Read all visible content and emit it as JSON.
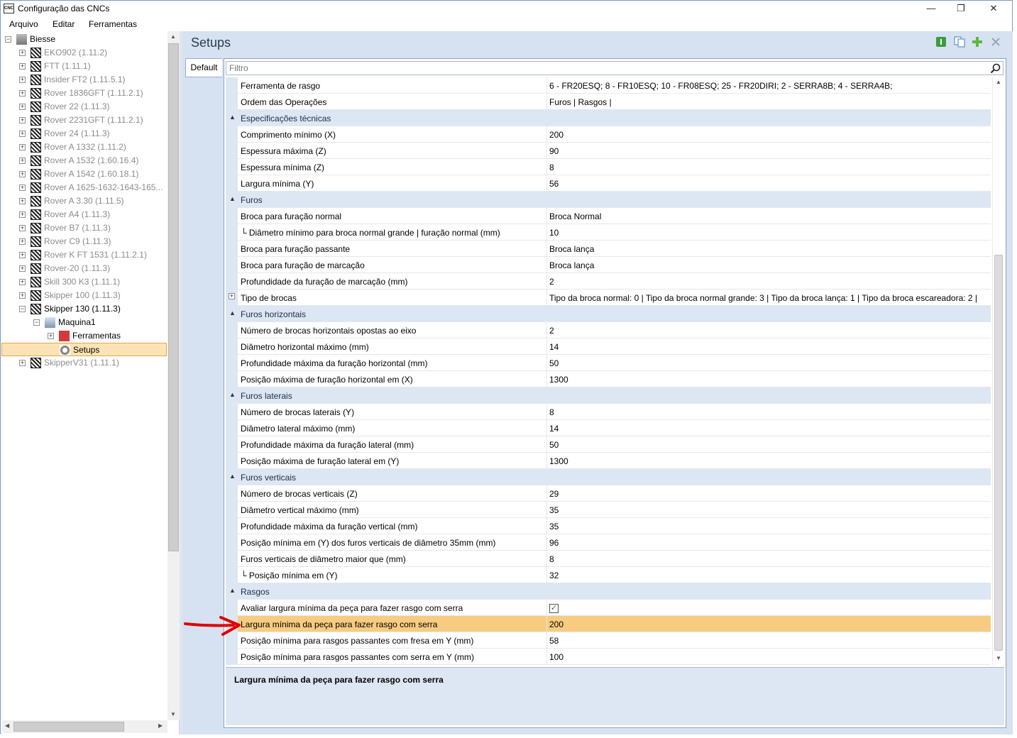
{
  "window": {
    "app_icon_text": "CNC",
    "title": "Configuração das CNCs",
    "controls": [
      "—",
      "❐",
      "✕"
    ]
  },
  "menu": [
    "Arquivo",
    "Editar",
    "Ferramentas"
  ],
  "tree": {
    "root": "Biesse",
    "machines": [
      "EKO902 (1.11.2)",
      "FTT (1.11.1)",
      "Insider FT2 (1.11.5.1)",
      "Rover 1836GFT (1.11.2.1)",
      "Rover 22 (1.11.3)",
      "Rover 2231GFT (1.11.2.1)",
      "Rover 24 (1.11.3)",
      "Rover A 1332 (1.11.2)",
      "Rover A 1532 (1.60.16.4)",
      "Rover A 1542 (1.60.18.1)",
      "Rover A 1625-1632-1643-165...",
      "Rover A 3.30 (1.11.5)",
      "Rover A4 (1.11.3)",
      "Rover B7 (1.11.3)",
      "Rover C9 (1.11.3)",
      "Rover K FT 1531 (1.11.2.1)",
      "Rover-20 (1.11.3)",
      "Skill 300 K3 (1.11.1)",
      "Skipper 100 (1.11.3)"
    ],
    "expanded": "Skipper 130 (1.11.3)",
    "machine_child": "Maquina1",
    "tools": "Ferramentas",
    "selected": "Setups",
    "last": "SkipperV31 (1.11.1)"
  },
  "right": {
    "title": "Setups",
    "tab": "Default",
    "filter_placeholder": "Filtro",
    "description": "Largura mínima da peça para fazer rasgo com serra"
  },
  "rows": [
    {
      "type": "prop",
      "name": "Ferramenta de rasgo",
      "value": "6 - FR20ESQ; 8 - FR10ESQ; 10 - FR08ESQ; 25 - FR20DIRI; 2 - SERRA8B; 4 - SERRA4B;"
    },
    {
      "type": "prop",
      "name": "Ordem das Operações",
      "value": "Furos | Rasgos |"
    },
    {
      "type": "cat",
      "name": "Especificações técnicas"
    },
    {
      "type": "prop",
      "name": "Comprimento mínimo (X)",
      "value": "200"
    },
    {
      "type": "prop",
      "name": "Espessura máxima (Z)",
      "value": "90"
    },
    {
      "type": "prop",
      "name": "Espessura mínima (Z)",
      "value": "8"
    },
    {
      "type": "prop",
      "name": "Largura mínima (Y)",
      "value": "56"
    },
    {
      "type": "cat",
      "name": "Furos"
    },
    {
      "type": "prop",
      "name": "Broca para furação normal",
      "value": "Broca Normal"
    },
    {
      "type": "prop",
      "name": "└ Diâmetro mínimo para broca normal grande | furação normal (mm)",
      "value": "10"
    },
    {
      "type": "prop",
      "name": "Broca para furação passante",
      "value": "Broca lança"
    },
    {
      "type": "prop",
      "name": "Broca para furação de marcação",
      "value": "Broca lança"
    },
    {
      "type": "prop",
      "name": "Profundidade da furação de marcação (mm)",
      "value": "2"
    },
    {
      "type": "prop",
      "name": "Tipo de brocas",
      "value": "Tipo da broca normal: 0  |  Tipo da broca normal grande: 3  |  Tipo da broca lança: 1  |  Tipo da broca escareadora: 2  |",
      "expandable": true
    },
    {
      "type": "cat",
      "name": "Furos horizontais"
    },
    {
      "type": "prop",
      "name": "Número de brocas horizontais opostas ao eixo",
      "value": "2"
    },
    {
      "type": "prop",
      "name": "Diâmetro horizontal máximo (mm)",
      "value": "14"
    },
    {
      "type": "prop",
      "name": "Profundidade máxima da furação horizontal (mm)",
      "value": "50"
    },
    {
      "type": "prop",
      "name": "Posição máxima de furação horizontal em (X)",
      "value": "1300"
    },
    {
      "type": "cat",
      "name": "Furos laterais"
    },
    {
      "type": "prop",
      "name": "Número de brocas laterais (Y)",
      "value": "8"
    },
    {
      "type": "prop",
      "name": "Diâmetro lateral máximo (mm)",
      "value": "14"
    },
    {
      "type": "prop",
      "name": "Profundidade máxima da furação lateral (mm)",
      "value": "50"
    },
    {
      "type": "prop",
      "name": "Posição máxima de furação lateral em (Y)",
      "value": "1300"
    },
    {
      "type": "cat",
      "name": "Furos verticais"
    },
    {
      "type": "prop",
      "name": "Número de brocas verticais (Z)",
      "value": "29"
    },
    {
      "type": "prop",
      "name": "Diâmetro vertical máximo (mm)",
      "value": "35"
    },
    {
      "type": "prop",
      "name": "Profundidade máxima da furação vertical (mm)",
      "value": "35"
    },
    {
      "type": "prop",
      "name": "Posição mínima em (Y) dos furos verticais de diâmetro 35mm (mm)",
      "value": "96"
    },
    {
      "type": "prop",
      "name": "Furos verticais de diâmetro maior que (mm)",
      "value": "8"
    },
    {
      "type": "prop",
      "name": "└ Posição mínima em (Y)",
      "value": "32"
    },
    {
      "type": "cat",
      "name": "Rasgos"
    },
    {
      "type": "prop",
      "name": "Avaliar largura mínima da peça para fazer rasgo com serra",
      "value": "",
      "checkbox": true
    },
    {
      "type": "prop",
      "name": "Largura mínima da peça para fazer rasgo com serra",
      "value": "200",
      "selected": true
    },
    {
      "type": "prop",
      "name": "Posição mínima para rasgos passantes com fresa em Y (mm)",
      "value": "58"
    },
    {
      "type": "prop",
      "name": "Posição mínima para rasgos passantes com serra em Y (mm)",
      "value": "100"
    }
  ],
  "colors": {
    "accent": "#f7cc80",
    "category": "#dde6f3",
    "arrow": "#e00000"
  }
}
